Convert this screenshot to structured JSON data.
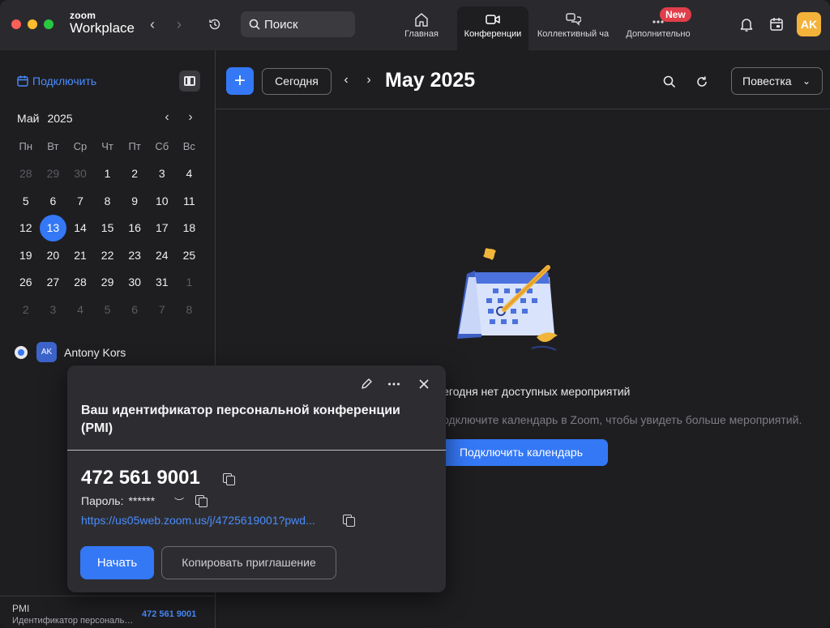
{
  "app": {
    "logo_small": "zoom",
    "logo_large": "Workplace",
    "search_placeholder": "Поиск"
  },
  "tabs": [
    {
      "label": "Главная",
      "icon": "home-icon"
    },
    {
      "label": "Конференции",
      "icon": "video-camera-icon",
      "active": true
    },
    {
      "label": "Коллективный ча",
      "icon": "chat-bubbles-icon"
    },
    {
      "label": "Дополнительно",
      "icon": "more-dots-icon"
    }
  ],
  "new_badge": "New",
  "user_initials": "AK",
  "sidebar": {
    "connect_label": "Подключить",
    "month": "Май",
    "year": "2025",
    "weekdays": [
      "Пн",
      "Вт",
      "Ср",
      "Чт",
      "Пт",
      "Сб",
      "Вс"
    ],
    "weeks": [
      [
        "28",
        "29",
        "30",
        "1",
        "2",
        "3",
        "4"
      ],
      [
        "5",
        "6",
        "7",
        "8",
        "9",
        "10",
        "11"
      ],
      [
        "12",
        "13",
        "14",
        "15",
        "16",
        "17",
        "18"
      ],
      [
        "19",
        "20",
        "21",
        "22",
        "23",
        "24",
        "25"
      ],
      [
        "26",
        "27",
        "28",
        "29",
        "30",
        "31",
        "1"
      ],
      [
        "2",
        "3",
        "4",
        "5",
        "6",
        "7",
        "8"
      ]
    ],
    "selected_day": "13",
    "user_name": "Antony Kors",
    "user_initials": "AK",
    "pmi_label": "PMI",
    "pmi_desc": "Идентификатор персональной конференции",
    "pmi_number": "472 561 9001"
  },
  "main": {
    "today_label": "Сегодня",
    "month_title": "May 2025",
    "view_label": "Повестка",
    "empty_title": "Сегодня нет доступных мероприятий",
    "empty_hint": "Подключите календарь в Zoom, чтобы увидеть больше мероприятий.",
    "connect_calendar_label": "Подключить календарь"
  },
  "popup": {
    "title": "Ваш идентификатор персональной конференции (PMI)",
    "meeting_id": "472 561 9001",
    "password_label": "Пароль:",
    "password_value": "******",
    "link": "https://us05web.zoom.us/j/4725619001?pwd...",
    "start_label": "Начать",
    "copy_invite_label": "Копировать приглашение"
  },
  "colors": {
    "accent": "#3478f6",
    "link": "#4a8cff",
    "badge": "#e03e4a",
    "avatar": "#f3b23a"
  }
}
